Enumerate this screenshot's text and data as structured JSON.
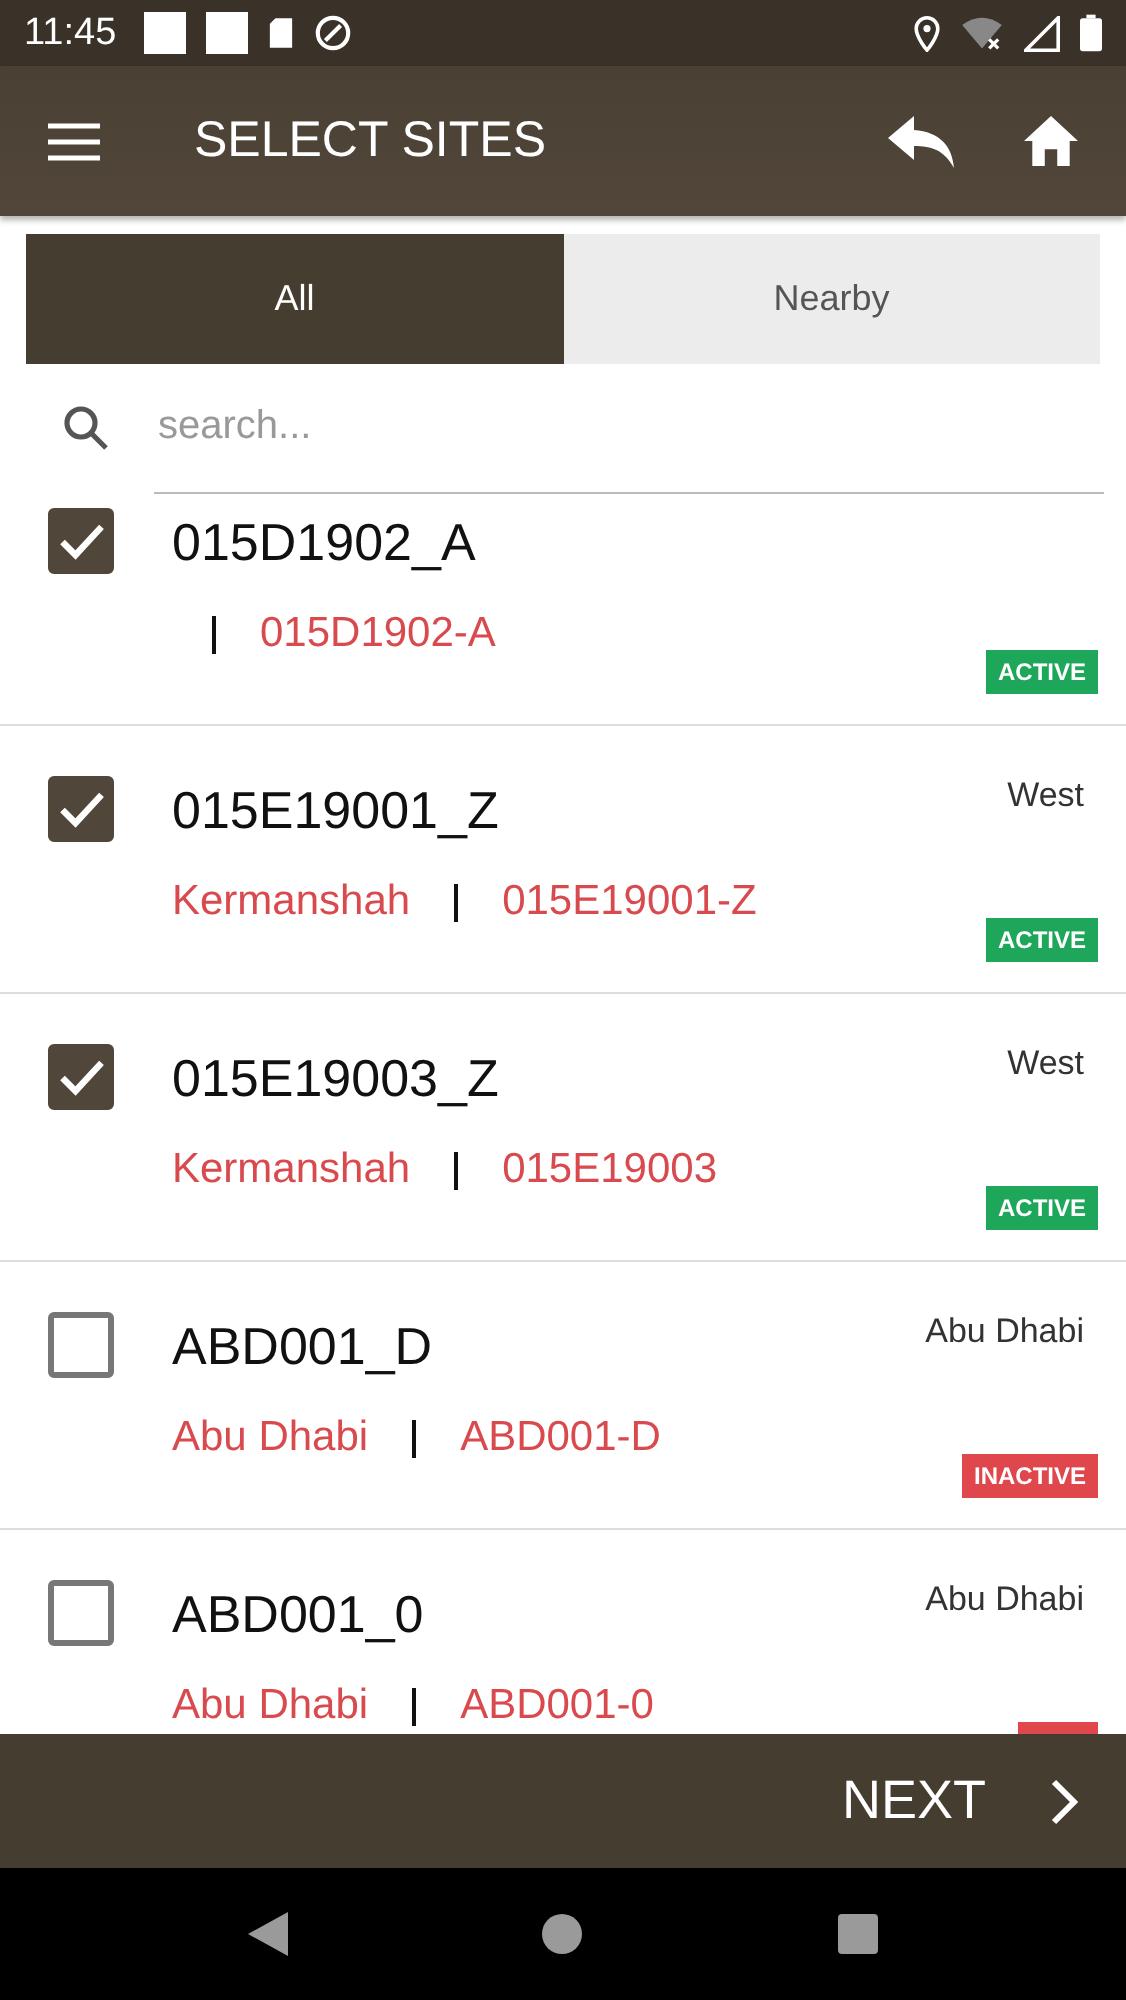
{
  "status_bar": {
    "time": "11:45"
  },
  "app_bar": {
    "title": "SELECT SITES"
  },
  "tabs": [
    {
      "label": "All",
      "selected": true
    },
    {
      "label": "Nearby",
      "selected": false
    }
  ],
  "search": {
    "placeholder": "search..."
  },
  "sites": [
    {
      "name": "015D1902_A",
      "code": "015D1902-A",
      "checked": true,
      "kind": "active",
      "status_label": "ACTIVE"
    },
    {
      "name": "015E19001_Z",
      "region": "West",
      "city": "Kermanshah",
      "code": "015E19001-Z",
      "checked": true,
      "kind": "active",
      "status_label": "ACTIVE"
    },
    {
      "name": "015E19003_Z",
      "region": "West",
      "city": "Kermanshah",
      "code": "015E19003",
      "checked": true,
      "kind": "active",
      "status_label": "ACTIVE"
    },
    {
      "name": "ABD001_D",
      "region": "Abu Dhabi",
      "city": "Abu Dhabi",
      "code": "ABD001-D",
      "checked": false,
      "kind": "inactive",
      "status_label": "INACTIVE"
    },
    {
      "name": "ABD001_0",
      "region": "Abu Dhabi",
      "city": "Abu Dhabi",
      "code": "ABD001-0",
      "checked": false,
      "kind": "inactive"
    }
  ],
  "footer": {
    "next_label": "NEXT"
  }
}
